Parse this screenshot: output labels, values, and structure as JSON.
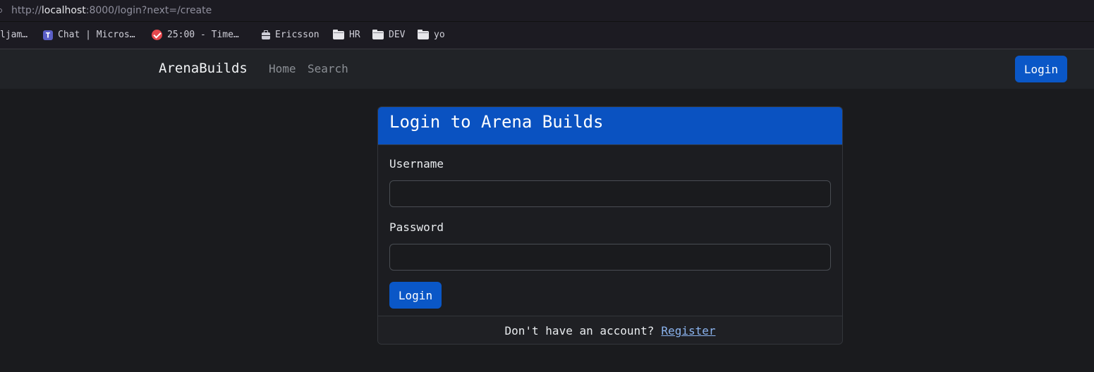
{
  "browser": {
    "url_scheme": "http://",
    "url_host": "localhost",
    "url_rest": ":8000/login?next=/create",
    "bookmarks": [
      {
        "label": "ljam…",
        "icon": "none"
      },
      {
        "label": "Chat | Micros…",
        "icon": "teams-icon"
      },
      {
        "label": "25:00 - Time…",
        "icon": "check-circle-icon"
      },
      {
        "label": "Ericsson",
        "icon": "briefcase-icon"
      },
      {
        "label": "HR",
        "icon": "folder-icon"
      },
      {
        "label": "DEV",
        "icon": "folder-icon"
      },
      {
        "label": "yo",
        "icon": "folder-icon"
      }
    ]
  },
  "navbar": {
    "brand": "ArenaBuilds",
    "links": [
      "Home",
      "Search"
    ],
    "login_label": "Login"
  },
  "login_card": {
    "title": "Login to Arena Builds",
    "username_label": "Username",
    "username_value": "",
    "password_label": "Password",
    "password_value": "",
    "submit_label": "Login",
    "footer_text": "Don't have an account?",
    "register_link": "Register"
  },
  "colors": {
    "primary": "#0a57c7",
    "background": "#1a1b1e",
    "navbar": "#212327",
    "link": "#8bb4ef"
  }
}
